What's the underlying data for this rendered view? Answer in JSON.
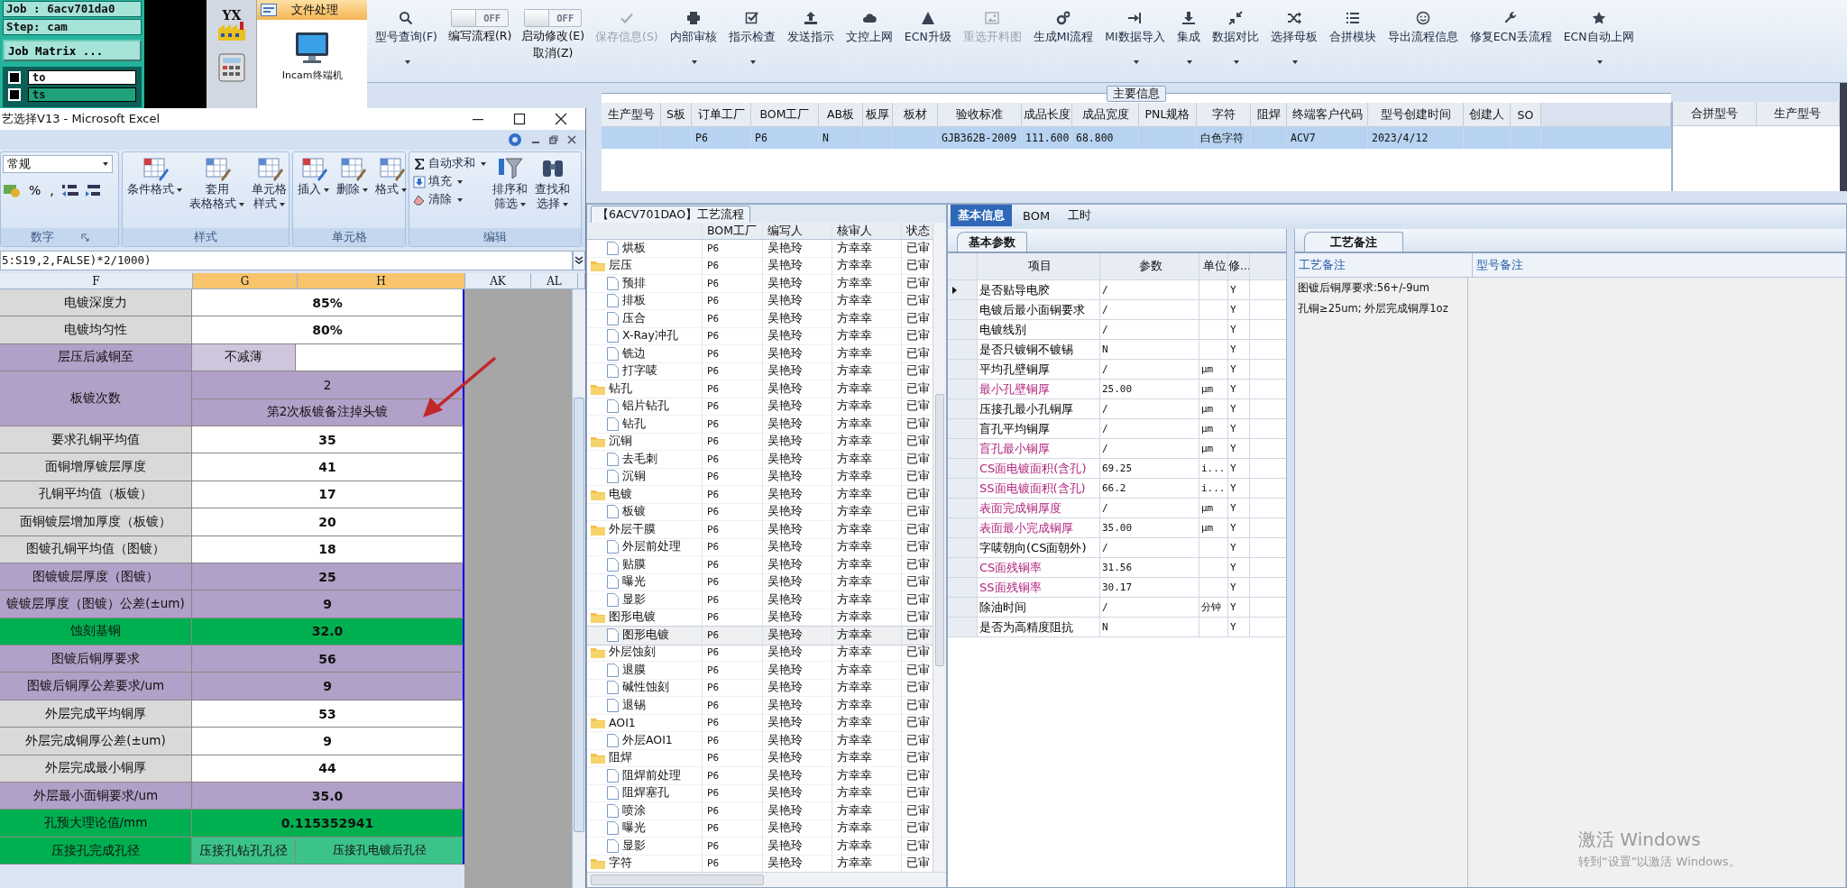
{
  "desktop": {
    "job": "Job : 6acv701da0",
    "step": "Step: cam",
    "matrix_button": "Job Matrix ...",
    "layers": [
      {
        "name": "to",
        "color": "#ffffff",
        "checked": false
      },
      {
        "name": "ts",
        "color": "#1fa27a",
        "checked": false
      }
    ]
  },
  "launcher": {
    "badge": "YX",
    "section": "文件处理",
    "app": "Incam终端机"
  },
  "toolbar": [
    {
      "kind": "button",
      "label": "型号查询(F)",
      "dropdown": true,
      "disabled": false
    },
    {
      "kind": "toggle",
      "switch": "OFF",
      "on": false,
      "label": "编写流程(R)"
    },
    {
      "kind": "toggle",
      "switch": "OFF",
      "on": false,
      "label": "启动修改(E)",
      "label2": "取消(Z)"
    },
    {
      "kind": "button",
      "label": "保存信息(S)",
      "dropdown": false,
      "disabled": true
    },
    {
      "kind": "button",
      "label": "内部审核",
      "dropdown": true,
      "disabled": false
    },
    {
      "kind": "button",
      "label": "指示检查",
      "dropdown": true,
      "disabled": false
    },
    {
      "kind": "button",
      "label": "发送指示",
      "dropdown": false,
      "disabled": false
    },
    {
      "kind": "button",
      "label": "文控上网",
      "dropdown": false,
      "disabled": false
    },
    {
      "kind": "button",
      "label": "ECN升级",
      "dropdown": false,
      "disabled": false
    },
    {
      "kind": "button",
      "label": "重选开料图",
      "dropdown": false,
      "disabled": true
    },
    {
      "kind": "button",
      "label": "生成MI流程",
      "dropdown": false,
      "disabled": false
    },
    {
      "kind": "button",
      "label": "MI数据导入",
      "dropdown": true,
      "disabled": false
    },
    {
      "kind": "button",
      "label": "集成",
      "dropdown": true,
      "disabled": false
    },
    {
      "kind": "button",
      "label": "数据对比",
      "dropdown": true,
      "disabled": false
    },
    {
      "kind": "button",
      "label": "选择母板",
      "dropdown": true,
      "disabled": false
    },
    {
      "kind": "button",
      "label": "合拼模块",
      "dropdown": false,
      "disabled": false
    },
    {
      "kind": "button",
      "label": "导出流程信息",
      "dropdown": false,
      "disabled": false
    },
    {
      "kind": "button",
      "label": "修复ECN丢流程",
      "dropdown": false,
      "disabled": false
    },
    {
      "kind": "button",
      "label": "ECN自动上网",
      "dropdown": true,
      "disabled": false
    }
  ],
  "main_info": {
    "title": "主要信息",
    "columns": [
      "生产型号",
      "S板",
      "订单工厂",
      "BOM工厂",
      "AB板",
      "板厚",
      "板材",
      "验收标准",
      "成品长度",
      "成品宽度",
      "PNL规格",
      "字符",
      "阻焊",
      "终端客户代码",
      "型号创建时间",
      "创建人",
      "SO"
    ],
    "rows": [
      {
        "selected": true,
        "cells": [
          null,
          null,
          "P6",
          "P6",
          "N",
          null,
          null,
          "GJB362B-2009",
          "111.600",
          "68.800",
          null,
          "白色字符",
          null,
          "ACV7",
          "2023/4/12",
          null,
          null
        ]
      }
    ]
  },
  "merge_panel": {
    "columns": [
      "合拼型号",
      "生产型号"
    ]
  },
  "process_tree": {
    "title": "【6ACV701DAO】工艺流程",
    "columns": [
      "BOM工厂",
      "编写人",
      "核审人",
      "状态"
    ],
    "nodes": [
      {
        "kind": "cut",
        "children": [
          {
            "name": "烘板",
            "kind": "file",
            "factory": "P6",
            "author": "吴艳玲",
            "reviewer": "方幸幸",
            "status": "已审",
            "selected": false
          }
        ]
      },
      {
        "name": "层压",
        "kind": "folder",
        "factory": "P6",
        "author": "吴艳玲",
        "reviewer": "方幸幸",
        "status": "已审",
        "selected": false,
        "children": [
          {
            "name": "预排",
            "kind": "file",
            "factory": "P6",
            "author": "吴艳玲",
            "reviewer": "方幸幸",
            "status": "已审",
            "selected": false
          },
          {
            "name": "排板",
            "kind": "file",
            "factory": "P6",
            "author": "吴艳玲",
            "reviewer": "方幸幸",
            "status": "已审",
            "selected": false
          },
          {
            "name": "压合",
            "kind": "file",
            "factory": "P6",
            "author": "吴艳玲",
            "reviewer": "方幸幸",
            "status": "已审",
            "selected": false
          },
          {
            "name": "X-Ray冲孔",
            "kind": "file",
            "factory": "P6",
            "author": "吴艳玲",
            "reviewer": "方幸幸",
            "status": "已审",
            "selected": false
          },
          {
            "name": "铣边",
            "kind": "file",
            "factory": "P6",
            "author": "吴艳玲",
            "reviewer": "方幸幸",
            "status": "已审",
            "selected": false
          },
          {
            "name": "打字唛",
            "kind": "file",
            "factory": "P6",
            "author": "吴艳玲",
            "reviewer": "方幸幸",
            "status": "已审",
            "selected": false
          }
        ]
      },
      {
        "name": "钻孔",
        "kind": "folder",
        "factory": "P6",
        "author": "吴艳玲",
        "reviewer": "方幸幸",
        "status": "已审",
        "selected": false,
        "children": [
          {
            "name": "铝片钻孔",
            "kind": "file",
            "factory": "P6",
            "author": "吴艳玲",
            "reviewer": "方幸幸",
            "status": "已审",
            "selected": false
          },
          {
            "name": "钻孔",
            "kind": "file",
            "factory": "P6",
            "author": "吴艳玲",
            "reviewer": "方幸幸",
            "status": "已审",
            "selected": false
          }
        ]
      },
      {
        "name": "沉铜",
        "kind": "folder",
        "factory": "P6",
        "author": "吴艳玲",
        "reviewer": "方幸幸",
        "status": "已审",
        "selected": false,
        "children": [
          {
            "name": "去毛刺",
            "kind": "file",
            "factory": "P6",
            "author": "吴艳玲",
            "reviewer": "方幸幸",
            "status": "已审",
            "selected": false
          },
          {
            "name": "沉铜",
            "kind": "file",
            "factory": "P6",
            "author": "吴艳玲",
            "reviewer": "方幸幸",
            "status": "已审",
            "selected": false
          }
        ]
      },
      {
        "name": "电镀",
        "kind": "folder",
        "factory": "P6",
        "author": "吴艳玲",
        "reviewer": "方幸幸",
        "status": "已审",
        "selected": false,
        "children": [
          {
            "name": "板镀",
            "kind": "file",
            "factory": "P6",
            "author": "吴艳玲",
            "reviewer": "方幸幸",
            "status": "已审",
            "selected": false
          }
        ]
      },
      {
        "name": "外层干膜",
        "kind": "folder",
        "factory": "P6",
        "author": "吴艳玲",
        "reviewer": "方幸幸",
        "status": "已审",
        "selected": false,
        "children": [
          {
            "name": "外层前处理",
            "kind": "file",
            "factory": "P6",
            "author": "吴艳玲",
            "reviewer": "方幸幸",
            "status": "已审",
            "selected": false
          },
          {
            "name": "贴膜",
            "kind": "file",
            "factory": "P6",
            "author": "吴艳玲",
            "reviewer": "方幸幸",
            "status": "已审",
            "selected": false
          },
          {
            "name": "曝光",
            "kind": "file",
            "factory": "P6",
            "author": "吴艳玲",
            "reviewer": "方幸幸",
            "status": "已审",
            "selected": false
          },
          {
            "name": "显影",
            "kind": "file",
            "factory": "P6",
            "author": "吴艳玲",
            "reviewer": "方幸幸",
            "status": "已审",
            "selected": false
          }
        ]
      },
      {
        "name": "图形电镀",
        "kind": "folder",
        "factory": "P6",
        "author": "吴艳玲",
        "reviewer": "方幸幸",
        "status": "已审",
        "selected": false,
        "children": [
          {
            "name": "图形电镀",
            "kind": "file",
            "factory": "P6",
            "author": "吴艳玲",
            "reviewer": "方幸幸",
            "status": "已审",
            "selected": true
          }
        ]
      },
      {
        "name": "外层蚀刻",
        "kind": "folder",
        "factory": "P6",
        "author": "吴艳玲",
        "reviewer": "方幸幸",
        "status": "已审",
        "selected": false,
        "children": [
          {
            "name": "退膜",
            "kind": "file",
            "factory": "P6",
            "author": "吴艳玲",
            "reviewer": "方幸幸",
            "status": "已审",
            "selected": false
          },
          {
            "name": "碱性蚀刻",
            "kind": "file",
            "factory": "P6",
            "author": "吴艳玲",
            "reviewer": "方幸幸",
            "status": "已审",
            "selected": false
          },
          {
            "name": "退锡",
            "kind": "file",
            "factory": "P6",
            "author": "吴艳玲",
            "reviewer": "方幸幸",
            "status": "已审",
            "selected": false
          }
        ]
      },
      {
        "name": "AOI1",
        "kind": "folder",
        "factory": "P6",
        "author": "吴艳玲",
        "reviewer": "方幸幸",
        "status": "已审",
        "selected": false,
        "children": [
          {
            "name": "外层AOI1",
            "kind": "file",
            "factory": "P6",
            "author": "吴艳玲",
            "reviewer": "方幸幸",
            "status": "已审",
            "selected": false
          }
        ]
      },
      {
        "name": "阻焊",
        "kind": "folder",
        "factory": "P6",
        "author": "吴艳玲",
        "reviewer": "方幸幸",
        "status": "已审",
        "selected": false,
        "children": [
          {
            "name": "阻焊前处理",
            "kind": "file",
            "factory": "P6",
            "author": "吴艳玲",
            "reviewer": "方幸幸",
            "status": "已审",
            "selected": false
          },
          {
            "name": "阻焊塞孔",
            "kind": "file",
            "factory": "P6",
            "author": "吴艳玲",
            "reviewer": "方幸幸",
            "status": "已审",
            "selected": false
          },
          {
            "name": "喷涂",
            "kind": "file",
            "factory": "P6",
            "author": "吴艳玲",
            "reviewer": "方幸幸",
            "status": "已审",
            "selected": false
          },
          {
            "name": "曝光",
            "kind": "file",
            "factory": "P6",
            "author": "吴艳玲",
            "reviewer": "方幸幸",
            "status": "已审",
            "selected": false
          },
          {
            "name": "显影",
            "kind": "file",
            "factory": "P6",
            "author": "吴艳玲",
            "reviewer": "方幸幸",
            "status": "已审",
            "selected": false
          }
        ]
      },
      {
        "name": "字符",
        "kind": "folder",
        "factory": "P6",
        "author": "吴艳玲",
        "reviewer": "方幸幸",
        "status": "已审",
        "selected": false
      }
    ]
  },
  "detail": {
    "tabs": [
      {
        "label": "基本信息",
        "selected": true
      },
      {
        "label": "BOM",
        "selected": false
      },
      {
        "label": "工时",
        "selected": false
      }
    ],
    "params": {
      "tab": "基本参数",
      "columns": [
        "项目",
        "参数",
        "单位",
        "修..."
      ],
      "rows": [
        {
          "item": "是否贴导电胶",
          "value": "/",
          "flag": "Y",
          "emphasis": false,
          "selected": true
        },
        {
          "item": "电镀后最小面铜要求",
          "value": "/",
          "flag": "Y",
          "emphasis": false,
          "selected": false
        },
        {
          "item": "电镀线别",
          "value": "/",
          "flag": "Y",
          "emphasis": false,
          "selected": false
        },
        {
          "item": "是否只镀铜不镀锡",
          "value": "N",
          "flag": "Y",
          "emphasis": false,
          "selected": false
        },
        {
          "item": "平均孔壁铜厚",
          "value": "/",
          "unit": "μm",
          "flag": "Y",
          "emphasis": false,
          "selected": false
        },
        {
          "item": "最小孔壁铜厚",
          "value": "25.00",
          "unit": "μm",
          "flag": "Y",
          "emphasis": true,
          "selected": false
        },
        {
          "item": "压接孔最小孔铜厚",
          "value": "/",
          "unit": "μm",
          "flag": "Y",
          "emphasis": false,
          "selected": false
        },
        {
          "item": "盲孔平均铜厚",
          "value": "/",
          "unit": "μm",
          "flag": "Y",
          "emphasis": false,
          "selected": false
        },
        {
          "item": "盲孔最小铜厚",
          "value": "/",
          "unit": "μm",
          "flag": "Y",
          "emphasis": true,
          "selected": false
        },
        {
          "item": "CS面电镀面积(含孔)",
          "value": "69.25",
          "unit": "i...",
          "flag": "Y",
          "emphasis": true,
          "selected": false
        },
        {
          "item": "SS面电镀面积(含孔)",
          "value": "66.2",
          "unit": "i...",
          "flag": "Y",
          "emphasis": true,
          "selected": false
        },
        {
          "item": "表面完成铜厚度",
          "value": "/",
          "unit": "μm",
          "flag": "Y",
          "emphasis": true,
          "selected": false
        },
        {
          "item": "表面最小完成铜厚",
          "value": "35.00",
          "unit": "μm",
          "flag": "Y",
          "emphasis": true,
          "selected": false
        },
        {
          "item": "字唛朝向(CS面朝外)",
          "value": "/",
          "flag": "Y",
          "emphasis": false,
          "selected": false
        },
        {
          "item": "CS面残铜率",
          "value": "31.56",
          "flag": "Y",
          "emphasis": true,
          "selected": false
        },
        {
          "item": "SS面残铜率",
          "value": "30.17",
          "flag": "Y",
          "emphasis": true,
          "selected": false
        },
        {
          "item": "除油时间",
          "value": "/",
          "unit": "分钟",
          "flag": "Y",
          "emphasis": false,
          "selected": false
        },
        {
          "item": "是否为高精度阻抗",
          "value": "N",
          "flag": "Y",
          "emphasis": false,
          "selected": false
        }
      ]
    },
    "notes": {
      "tab": "工艺备注",
      "columns": [
        "工艺备注",
        "型号备注"
      ],
      "lines": [
        "图镀后铜厚要求:56+/-9um",
        "孔铜≥25um; 外层完成铜厚1oz"
      ]
    }
  },
  "excel": {
    "title": "艺选择V13 - Microsoft Excel",
    "groups": [
      {
        "kind": "number",
        "label": "数字",
        "format": "常规",
        "buttons": [
          "%",
          ","
        ]
      },
      {
        "kind": "large",
        "label": "样式",
        "buttons": [
          {
            "lines": [
              "条件格式"
            ],
            "dropdown": true
          },
          {
            "lines": [
              "套用",
              "表格格式"
            ],
            "dropdown": true
          },
          {
            "lines": [
              "单元格",
              "样式"
            ],
            "dropdown": true
          }
        ]
      },
      {
        "kind": "large",
        "label": "单元格",
        "buttons": [
          {
            "lines": [
              "插入"
            ],
            "dropdown": true
          },
          {
            "lines": [
              "删除"
            ],
            "dropdown": true
          },
          {
            "lines": [
              "格式"
            ],
            "dropdown": true
          }
        ]
      },
      {
        "kind": "edit",
        "label": "编辑",
        "small": [
          {
            "label": "自动求和",
            "dropdown": true
          },
          {
            "label": "填充",
            "dropdown": true
          },
          {
            "label": "清除",
            "dropdown": true
          }
        ],
        "buttons": [
          {
            "lines": [
              "排序和",
              "筛选"
            ],
            "dropdown": true
          },
          {
            "lines": [
              "查找和",
              "选择"
            ],
            "dropdown": true
          }
        ]
      }
    ],
    "formula": "5:S19,2,FALSE)*2/1000)",
    "columns": [
      {
        "label": "F",
        "selected": false
      },
      {
        "label": "G",
        "selected": true
      },
      {
        "label": "H",
        "selected": true
      },
      {
        "label": "AK",
        "selected": false
      },
      {
        "label": "AL",
        "selected": false
      }
    ],
    "rows": [
      {
        "kind": "plain",
        "label": "电镀深度力",
        "value": "85%"
      },
      {
        "kind": "plain",
        "label": "电镀均匀性",
        "value": "80%"
      },
      {
        "kind": "split",
        "label": "层压后减铜至",
        "value": "不减薄"
      },
      {
        "kind": "double",
        "label": "板镀次数",
        "value": "2",
        "note": "第2次板镀备注掉头镀"
      },
      {
        "kind": "plain",
        "label": "要求孔铜平均值",
        "value": "35"
      },
      {
        "kind": "plain",
        "label": "面铜增厚镀层厚度",
        "value": "41"
      },
      {
        "kind": "plain",
        "label": "孔铜平均值（板镀）",
        "value": "17"
      },
      {
        "kind": "plain",
        "label": "面铜镀层增加厚度（板镀）",
        "value": "20"
      },
      {
        "kind": "plain",
        "label": "图镀孔铜平均值（图镀）",
        "value": "18"
      },
      {
        "kind": "shaded",
        "label": "图镀镀层厚度（图镀）",
        "value": "25"
      },
      {
        "kind": "shaded",
        "label": "镀镀层厚度（图镀）公差(±um)",
        "value": "9"
      },
      {
        "kind": "highlight",
        "label": "蚀刻基铜",
        "value": "32.0"
      },
      {
        "kind": "shaded",
        "label": "图镀后铜厚要求",
        "value": "56"
      },
      {
        "kind": "shaded",
        "label": "图镀后铜厚公差要求/um",
        "value": "9"
      },
      {
        "kind": "plain",
        "label": "外层完成平均铜厚",
        "value": "53"
      },
      {
        "kind": "plain",
        "label": "外层完成铜厚公差(±um)",
        "value": "9"
      },
      {
        "kind": "plain",
        "label": "外层完成最小铜厚",
        "value": "44"
      },
      {
        "kind": "shaded",
        "label": "外层最小面铜要求/um",
        "value": "35.0"
      },
      {
        "kind": "highlight",
        "label": "孔预大理论值/mm",
        "value": "0.115352941"
      },
      {
        "kind": "triple",
        "label": "压接孔完成孔径",
        "value": "压接孔钻孔孔径",
        "note": "压接孔电镀后孔径"
      }
    ]
  },
  "os_notice": {
    "title": "激活 Windows",
    "hint": "转到“设置”以激活 Windows。"
  }
}
